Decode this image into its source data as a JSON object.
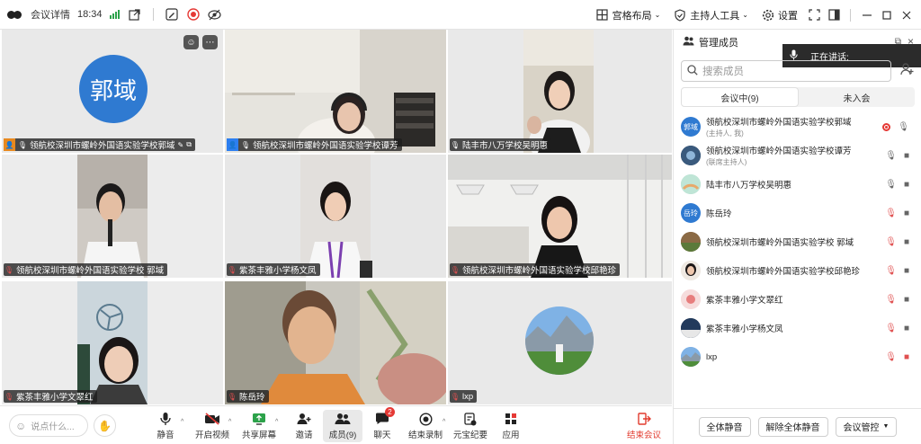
{
  "topbar": {
    "meeting_details": "会议详情",
    "time": "18:34",
    "grid_layout": "宫格布局",
    "host_tools": "主持人工具",
    "settings": "设置",
    "icons": [
      "meeting-logo-icon",
      "signal-icon",
      "share-out-icon",
      "annotate-icon",
      "record-icon",
      "hide-icon",
      "grid-icon",
      "shield-icon",
      "gear-icon",
      "fullscreen-icon",
      "sidebar-toggle-icon",
      "minimize-icon",
      "maximize-icon",
      "close-icon"
    ]
  },
  "tiles": [
    {
      "name": "领航校深圳市螺岭外国语实验学校郭域",
      "avatar_text": "郭域",
      "badge": "host",
      "avatar_color": "#2f7ad1"
    },
    {
      "name": "领航校深圳市螺岭外国语实验学校谭芳",
      "badge": "cohost"
    },
    {
      "name": "陆丰市八万学校吴明惠"
    },
    {
      "name": "领航校深圳市螺岭外国语实验学校 郭域"
    },
    {
      "name": "紫茶丰雅小学杨文凤"
    },
    {
      "name": "领航校深圳市螺岭外国语实验学校邱艳珍"
    },
    {
      "name": "紫茶丰雅小学文翠红"
    },
    {
      "name": "陈岳玲"
    },
    {
      "name": "lxp"
    }
  ],
  "toolbar": {
    "chat_placeholder": "说点什么...",
    "mute": "静音",
    "start_video": "开启视频",
    "share_screen": "共享屏幕",
    "invite": "邀请",
    "members": "成员(9)",
    "chat": "聊天",
    "chat_badge": "2",
    "end_recording": "结束录制",
    "yuanbao_minutes": "元宝纪要",
    "apps": "应用",
    "leave": "结束会议"
  },
  "panel": {
    "title": "管理成员",
    "speaking_label": "正在讲话:",
    "search_placeholder": "搜索成员",
    "tab_in_meeting": "会议中(9)",
    "tab_not_joined": "未入会",
    "members": [
      {
        "name": "领航校深圳市螺岭外国语实验学校郭域",
        "role": "(主持人, 我)",
        "avatar": "郭域",
        "recording": true,
        "mic": "on",
        "cam": "none"
      },
      {
        "name": "领航校深圳市螺岭外国语实验学校谭芳",
        "role": "(联席主持人)",
        "avatar": "",
        "mic": "on",
        "cam": "on"
      },
      {
        "name": "陆丰市八万学校吴明惠",
        "role": "",
        "avatar": "",
        "mic": "on",
        "cam": "on"
      },
      {
        "name": "陈岳玲",
        "role": "",
        "avatar": "岳玲",
        "mic": "off",
        "cam": "on"
      },
      {
        "name": "领航校深圳市螺岭外国语实验学校 郭域",
        "role": "",
        "avatar": "",
        "mic": "off",
        "cam": "on"
      },
      {
        "name": "领航校深圳市螺岭外国语实验学校邱艳珍",
        "role": "",
        "avatar": "",
        "mic": "off",
        "cam": "on"
      },
      {
        "name": "紫茶丰雅小学文翠红",
        "role": "",
        "avatar": "",
        "mic": "off",
        "cam": "on"
      },
      {
        "name": "紫茶丰雅小学杨文凤",
        "role": "",
        "avatar": "",
        "mic": "off",
        "cam": "on"
      },
      {
        "name": "lxp",
        "role": "",
        "avatar": "",
        "mic": "off",
        "cam": "off"
      }
    ],
    "mute_all": "全体静音",
    "unmute_all": "解除全体静音",
    "meeting_control": "会议管控"
  }
}
